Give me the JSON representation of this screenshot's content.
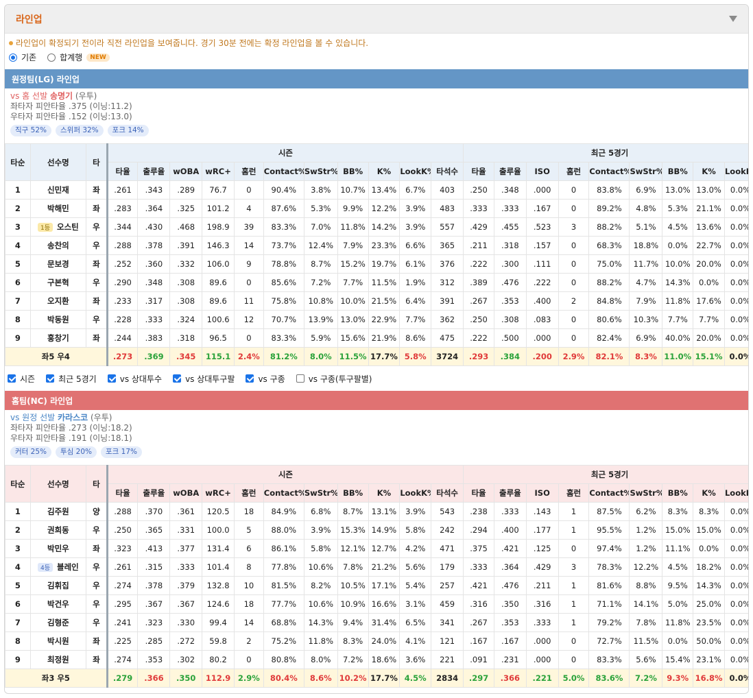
{
  "panel": {
    "title": "라인업"
  },
  "notice": "라인업이 확정되기 전이라 직전 라인업을 보여줍니다. 경기 30분 전에는 확정 라인업을 볼 수 있습니다.",
  "mode": {
    "option1": "기존",
    "option2": "합계행",
    "new_badge": "NEW",
    "selected": "기존"
  },
  "headers": {
    "order": "타순",
    "name": "선수명",
    "hand": "타",
    "season": "시즌",
    "recent": "최근 5경기",
    "season_cols": [
      "타율",
      "출루율",
      "wOBA",
      "wRC+",
      "홈런",
      "Contact%",
      "SwStr%",
      "BB%",
      "K%",
      "LookK%",
      "타석수"
    ],
    "recent_cols": [
      "타율",
      "출루율",
      "ISO",
      "홈런",
      "Contact%",
      "SwStr%",
      "BB%",
      "K%",
      "LookK%"
    ]
  },
  "away": {
    "bar": "원정팀(LG) 라인업",
    "vs_prefix": "vs 홈 선발",
    "pitcher": "송명기",
    "pitcher_hand": "(우투)",
    "vs_left": "좌타자 피안타율 .375 (이닝:11.2)",
    "vs_right": "우타자 피안타율 .152 (이닝:13.0)",
    "pitches": [
      "직구 52%",
      "스위퍼 32%",
      "포크 14%"
    ],
    "rows": [
      {
        "order": "1",
        "name": "신민재",
        "hand": "좌",
        "season": [
          ".261",
          ".343",
          ".289",
          "76.7",
          "0",
          "90.4%",
          "3.8%",
          "10.7%",
          "13.4%",
          "6.7%",
          "403"
        ],
        "recent": [
          ".250",
          ".348",
          ".000",
          "0",
          "83.8%",
          "6.9%",
          "13.0%",
          "13.0%",
          "0.0%"
        ]
      },
      {
        "order": "2",
        "name": "박해민",
        "hand": "좌",
        "season": [
          ".283",
          ".364",
          ".325",
          "101.2",
          "4",
          "87.6%",
          "5.3%",
          "9.9%",
          "12.2%",
          "3.9%",
          "483"
        ],
        "recent": [
          ".333",
          ".333",
          ".167",
          "0",
          "89.2%",
          "4.8%",
          "5.3%",
          "21.1%",
          "0.0%"
        ]
      },
      {
        "order": "3",
        "badge": "1등",
        "name": "오스틴",
        "hand": "우",
        "season": [
          ".344",
          ".430",
          ".468",
          "198.9",
          "39",
          "83.3%",
          "7.0%",
          "11.8%",
          "14.2%",
          "3.9%",
          "557"
        ],
        "recent": [
          ".429",
          ".455",
          ".523",
          "3",
          "88.2%",
          "5.1%",
          "4.5%",
          "13.6%",
          "0.0%"
        ]
      },
      {
        "order": "4",
        "name": "송찬의",
        "hand": "우",
        "season": [
          ".288",
          ".378",
          ".391",
          "146.3",
          "14",
          "73.7%",
          "12.4%",
          "7.9%",
          "23.3%",
          "6.6%",
          "365"
        ],
        "recent": [
          ".211",
          ".318",
          ".157",
          "0",
          "68.3%",
          "18.8%",
          "0.0%",
          "22.7%",
          "0.0%"
        ]
      },
      {
        "order": "5",
        "name": "문보경",
        "hand": "좌",
        "season": [
          ".252",
          ".360",
          ".332",
          "106.0",
          "9",
          "78.8%",
          "8.7%",
          "15.2%",
          "19.7%",
          "6.1%",
          "376"
        ],
        "recent": [
          ".222",
          ".300",
          ".111",
          "0",
          "75.0%",
          "11.7%",
          "10.0%",
          "20.0%",
          "0.0%"
        ]
      },
      {
        "order": "6",
        "name": "구본혁",
        "hand": "우",
        "season": [
          ".290",
          ".348",
          ".308",
          "89.6",
          "0",
          "85.6%",
          "7.2%",
          "7.7%",
          "11.5%",
          "1.9%",
          "312"
        ],
        "recent": [
          ".389",
          ".476",
          ".222",
          "0",
          "88.2%",
          "4.7%",
          "14.3%",
          "0.0%",
          "0.0%"
        ]
      },
      {
        "order": "7",
        "name": "오지환",
        "hand": "좌",
        "season": [
          ".233",
          ".317",
          ".308",
          "89.6",
          "11",
          "75.8%",
          "10.8%",
          "10.0%",
          "21.5%",
          "6.4%",
          "391"
        ],
        "recent": [
          ".267",
          ".353",
          ".400",
          "2",
          "84.8%",
          "7.9%",
          "11.8%",
          "17.6%",
          "0.0%"
        ]
      },
      {
        "order": "8",
        "name": "박동원",
        "hand": "우",
        "season": [
          ".228",
          ".333",
          ".324",
          "100.6",
          "12",
          "70.7%",
          "13.9%",
          "13.0%",
          "22.9%",
          "7.7%",
          "362"
        ],
        "recent": [
          ".250",
          ".308",
          ".083",
          "0",
          "80.6%",
          "10.3%",
          "7.7%",
          "7.7%",
          "0.0%"
        ]
      },
      {
        "order": "9",
        "name": "홍창기",
        "hand": "좌",
        "season": [
          ".244",
          ".383",
          ".318",
          "96.5",
          "0",
          "83.3%",
          "5.9%",
          "15.6%",
          "21.9%",
          "8.6%",
          "475"
        ],
        "recent": [
          ".222",
          ".500",
          ".000",
          "0",
          "82.4%",
          "6.9%",
          "40.0%",
          "20.0%",
          "0.0%"
        ]
      }
    ],
    "total": {
      "label": "좌5 우4",
      "season": [
        ".273",
        ".369",
        ".345",
        "115.1",
        "2.4%",
        "81.2%",
        "8.0%",
        "11.5%",
        "17.7%",
        "5.8%",
        "3724"
      ],
      "recent": [
        ".293",
        ".384",
        ".200",
        "2.9%",
        "82.1%",
        "8.3%",
        "11.0%",
        "15.1%",
        "0.0%"
      ]
    }
  },
  "filters": [
    "시즌",
    "최근 5경기",
    "vs 상대투수",
    "vs 상대투구팔",
    "vs 구종",
    "vs 구종(투구팔별)"
  ],
  "home": {
    "bar": "홈팀(NC) 라인업",
    "vs_prefix": "vs 원정 선발",
    "pitcher": "카라스코",
    "pitcher_hand": "(우투)",
    "vs_left": "좌타자 피안타율 .273 (이닝:18.2)",
    "vs_right": "우타자 피안타율 .191 (이닝:18.1)",
    "pitches": [
      "커터 25%",
      "투심 20%",
      "포크 17%"
    ],
    "rows": [
      {
        "order": "1",
        "name": "김주원",
        "hand": "양",
        "season": [
          ".288",
          ".370",
          ".361",
          "120.5",
          "18",
          "84.9%",
          "6.8%",
          "8.7%",
          "13.1%",
          "3.9%",
          "543"
        ],
        "recent": [
          ".238",
          ".333",
          ".143",
          "1",
          "87.5%",
          "6.2%",
          "8.3%",
          "8.3%",
          "0.0%"
        ]
      },
      {
        "order": "2",
        "name": "권희동",
        "hand": "우",
        "season": [
          ".250",
          ".365",
          ".331",
          "100.0",
          "5",
          "88.0%",
          "3.9%",
          "15.3%",
          "14.9%",
          "5.8%",
          "242"
        ],
        "recent": [
          ".294",
          ".400",
          ".177",
          "1",
          "95.5%",
          "1.2%",
          "15.0%",
          "15.0%",
          "0.0%"
        ]
      },
      {
        "order": "3",
        "name": "박민우",
        "hand": "좌",
        "season": [
          ".323",
          ".413",
          ".377",
          "131.4",
          "6",
          "86.1%",
          "5.8%",
          "12.1%",
          "12.7%",
          "4.2%",
          "471"
        ],
        "recent": [
          ".375",
          ".421",
          ".125",
          "0",
          "97.4%",
          "1.2%",
          "11.1%",
          "0.0%",
          "0.0%"
        ]
      },
      {
        "order": "4",
        "badge": "4등",
        "name": "블레인",
        "hand": "우",
        "season": [
          ".261",
          ".315",
          ".333",
          "101.4",
          "8",
          "77.8%",
          "10.6%",
          "7.8%",
          "21.2%",
          "5.6%",
          "179"
        ],
        "recent": [
          ".333",
          ".364",
          ".429",
          "3",
          "78.3%",
          "12.2%",
          "4.5%",
          "18.2%",
          "0.0%"
        ]
      },
      {
        "order": "5",
        "name": "김휘집",
        "hand": "우",
        "season": [
          ".274",
          ".378",
          ".379",
          "132.8",
          "10",
          "81.5%",
          "8.2%",
          "10.5%",
          "17.1%",
          "5.4%",
          "257"
        ],
        "recent": [
          ".421",
          ".476",
          ".211",
          "1",
          "81.6%",
          "8.8%",
          "9.5%",
          "14.3%",
          "0.0%"
        ]
      },
      {
        "order": "6",
        "name": "박건우",
        "hand": "우",
        "season": [
          ".295",
          ".367",
          ".367",
          "124.6",
          "18",
          "77.7%",
          "10.6%",
          "10.9%",
          "16.6%",
          "3.1%",
          "459"
        ],
        "recent": [
          ".316",
          ".350",
          ".316",
          "1",
          "71.1%",
          "14.1%",
          "5.0%",
          "25.0%",
          "0.0%"
        ]
      },
      {
        "order": "7",
        "name": "김형준",
        "hand": "우",
        "season": [
          ".241",
          ".323",
          ".330",
          "99.4",
          "14",
          "68.8%",
          "14.3%",
          "9.4%",
          "31.4%",
          "6.5%",
          "341"
        ],
        "recent": [
          ".267",
          ".353",
          ".333",
          "1",
          "79.2%",
          "7.8%",
          "11.8%",
          "23.5%",
          "0.0%"
        ]
      },
      {
        "order": "8",
        "name": "박시원",
        "hand": "좌",
        "season": [
          ".225",
          ".285",
          ".272",
          "59.8",
          "2",
          "75.2%",
          "11.8%",
          "8.3%",
          "24.0%",
          "4.1%",
          "121"
        ],
        "recent": [
          ".167",
          ".167",
          ".000",
          "0",
          "72.7%",
          "11.5%",
          "0.0%",
          "50.0%",
          "0.0%"
        ]
      },
      {
        "order": "9",
        "name": "최정원",
        "hand": "좌",
        "season": [
          ".274",
          ".353",
          ".302",
          "80.2",
          "0",
          "80.8%",
          "8.0%",
          "7.2%",
          "18.6%",
          "3.6%",
          "221"
        ],
        "recent": [
          ".091",
          ".231",
          ".000",
          "0",
          "83.3%",
          "5.6%",
          "15.4%",
          "23.1%",
          "0.0%"
        ]
      }
    ],
    "total": {
      "label": "좌3 우5",
      "season": [
        ".279",
        ".366",
        ".350",
        "112.9",
        "2.9%",
        "80.4%",
        "8.6%",
        "10.2%",
        "17.7%",
        "4.5%",
        "2834"
      ],
      "recent": [
        ".297",
        ".366",
        ".221",
        "5.0%",
        "83.6%",
        "7.2%",
        "9.3%",
        "16.8%",
        "0.0%"
      ]
    }
  },
  "colors": {
    "away_bar": "#6496c6",
    "home_bar": "#e07272",
    "title": "#d9661a",
    "good": "#2aa23a",
    "bad": "#e03a3a",
    "total_bg": "#fff7dc"
  }
}
